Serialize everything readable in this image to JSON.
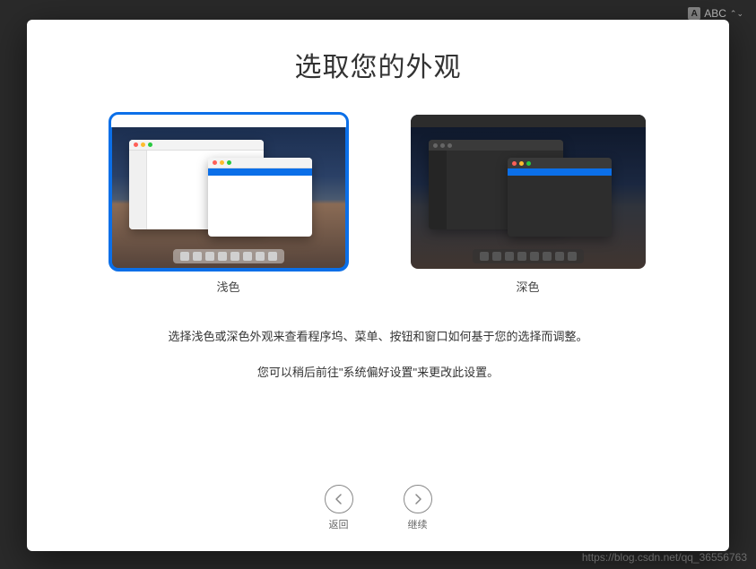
{
  "inputMethod": {
    "badge": "A",
    "label": "ABC"
  },
  "title": "选取您的外观",
  "options": {
    "light": {
      "label": "浅色",
      "selected": true
    },
    "dark": {
      "label": "深色",
      "selected": false
    }
  },
  "description": {
    "line1": "选择浅色或深色外观来查看程序坞、菜单、按钮和窗口如何基于您的选择而调整。",
    "line2": "您可以稍后前往\"系统偏好设置\"来更改此设置。"
  },
  "footer": {
    "back": "返回",
    "continue": "继续"
  },
  "watermark": "https://blog.csdn.net/qq_36556763"
}
